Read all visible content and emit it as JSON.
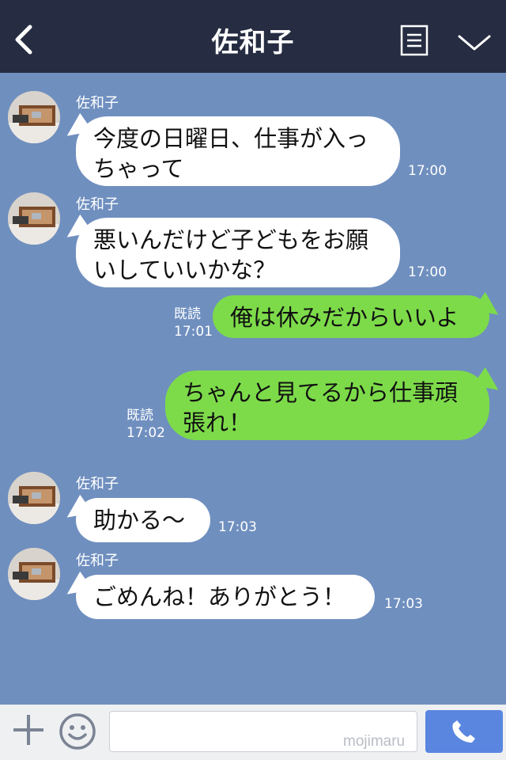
{
  "header": {
    "title": "佐和子"
  },
  "messages": [
    {
      "sender": "佐和子",
      "text": "今度の日曜日、仕事が入っちゃって",
      "time": "17:00"
    },
    {
      "sender": "佐和子",
      "text": "悪いんだけど子どもをお願いしていいかな？",
      "time": "17:00"
    },
    {
      "read": "既読",
      "time": "17:01",
      "text": "俺は休みだからいいよ"
    },
    {
      "read": "既読",
      "time": "17:02",
      "text": "ちゃんと見てるから仕事頑張れ！"
    },
    {
      "sender": "佐和子",
      "text": "助かる〜",
      "time": "17:03"
    },
    {
      "sender": "佐和子",
      "text": "ごめんね！ありがとう！",
      "time": "17:03"
    }
  ],
  "footer": {
    "input_value": "",
    "watermark": "mojimaru"
  },
  "colors": {
    "header_bg": "#262d42",
    "chat_bg": "#6f8fbf",
    "outgoing_bubble": "#7ddb4a",
    "call_button": "#5a86e0"
  },
  "icons": [
    "back-icon",
    "menu-icon",
    "chevron-down-icon",
    "plus-icon",
    "smiley-icon",
    "phone-icon"
  ]
}
